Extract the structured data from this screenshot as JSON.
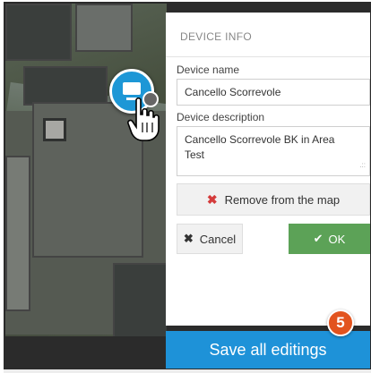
{
  "panel": {
    "title": "DEVICE INFO",
    "device_name_label": "Device name",
    "device_name_value": "Cancello Scorrevole",
    "device_description_label": "Device description",
    "device_description_value": "Cancello Scorrevole BK in Area Test",
    "remove_label": "Remove from the map",
    "cancel_label": "Cancel",
    "ok_label": "OK"
  },
  "save_all_label": "Save all editings",
  "step_badge": "5",
  "icons": {
    "remove": "x-icon",
    "cancel": "x-icon",
    "ok": "check-icon",
    "marker": "device-marker-icon",
    "cursor": "hand-pointer-icon"
  },
  "colors": {
    "primary": "#1e92d8",
    "ok": "#5ca257",
    "remove": "#d43b3b",
    "badge": "#e2531e"
  }
}
